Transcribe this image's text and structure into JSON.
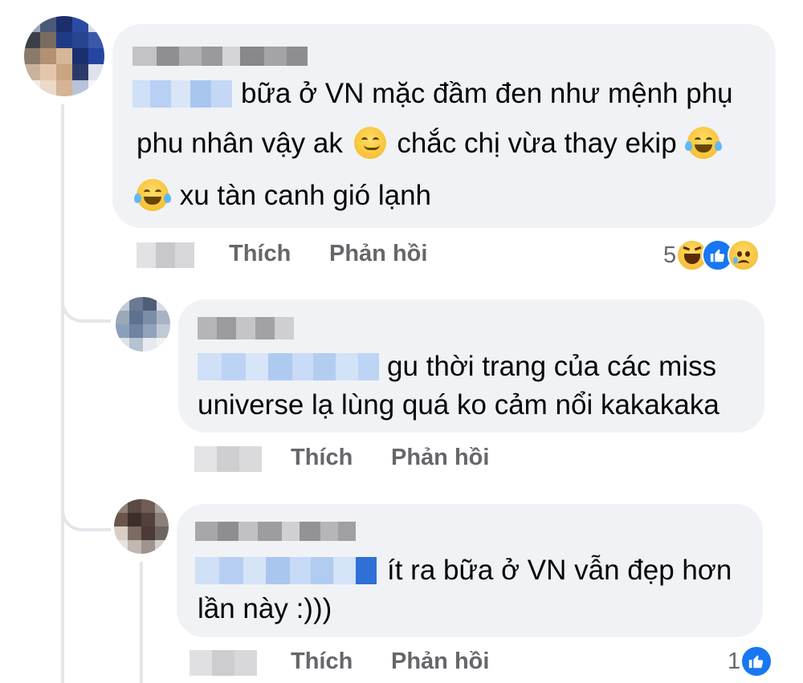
{
  "comments": [
    {
      "lines": [
        "bữa ở VN mặc đầm đen như mệnh phụ",
        "phu nhân vậy ak",
        "chắc chị vừa thay ekip",
        "xu tàn canh gió lạnh"
      ],
      "emojis": [
        "smirk-face-icon",
        "tears-of-joy-icon",
        "tears-of-joy-icon"
      ],
      "actions": {
        "like": "Thích",
        "reply": "Phản hồi"
      },
      "reaction_count": "5",
      "reaction_icons": [
        "haha-reaction-icon",
        "like-reaction-icon",
        "sad-reaction-icon"
      ]
    },
    {
      "lines": [
        "gu thời trang của các miss",
        "universe lạ lùng quá ko cảm nổi kakakaka"
      ],
      "actions": {
        "like": "Thích",
        "reply": "Phản hồi"
      }
    },
    {
      "lines": [
        "ít ra bữa ở VN vẫn đẹp hơn",
        "lần này :)))"
      ],
      "actions": {
        "like": "Thích",
        "reply": "Phản hồi"
      },
      "reaction_count": "1",
      "reaction_icons": [
        "like-reaction-icon"
      ]
    }
  ],
  "colors": {
    "bubble": "#f0f2f5",
    "text": "#050505",
    "secondary": "#65676b",
    "like_blue": "#1877f2",
    "thread_line": "#e4e6eb"
  }
}
